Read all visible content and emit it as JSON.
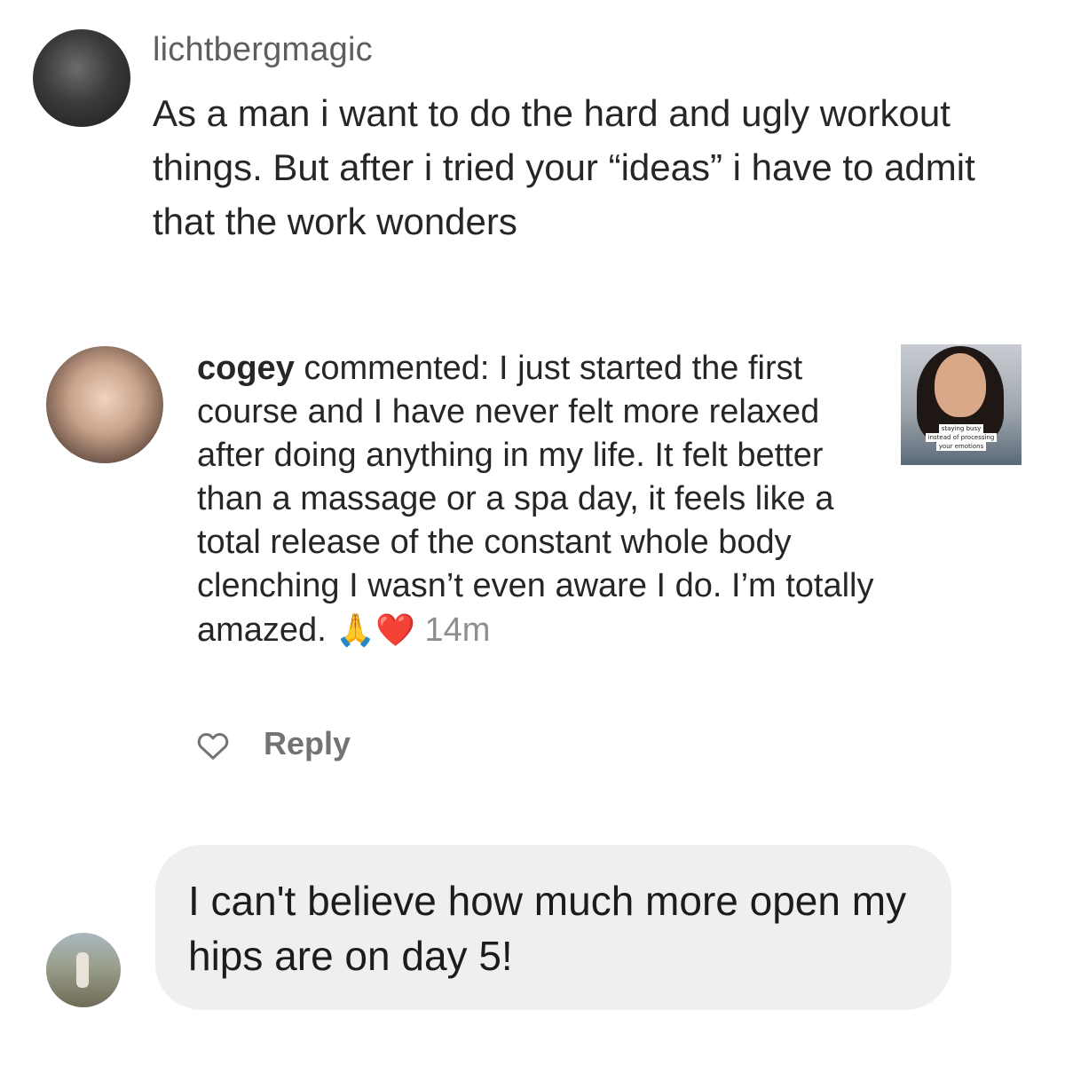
{
  "comments": [
    {
      "username": "lichtbergmagic",
      "text": "As a man i want to do the hard and ugly workout things. But after i tried your “ideas” i have to admit that the work wonders"
    },
    {
      "username": "cogey",
      "action": " commented: ",
      "text": "I just started the first course and I have never felt more relaxed after doing anything in my life. It felt better than a massage or a spa day, it feels like a total release of the constant whole body clenching I wasn’t even aware I do. I’m totally amazed. ",
      "emojis": "🙏❤️",
      "time": "14m",
      "reply_label": "Reply",
      "thumbnail_caption": [
        "staying busy",
        "instead of processing",
        "your emotions"
      ]
    },
    {
      "text": "I can't believe how much more open my hips are on day 5!"
    }
  ],
  "icons": {
    "like": "heart-outline-icon"
  },
  "colors": {
    "text": "#262626",
    "muted": "#8e8e8e",
    "bubble": "#efefef"
  }
}
